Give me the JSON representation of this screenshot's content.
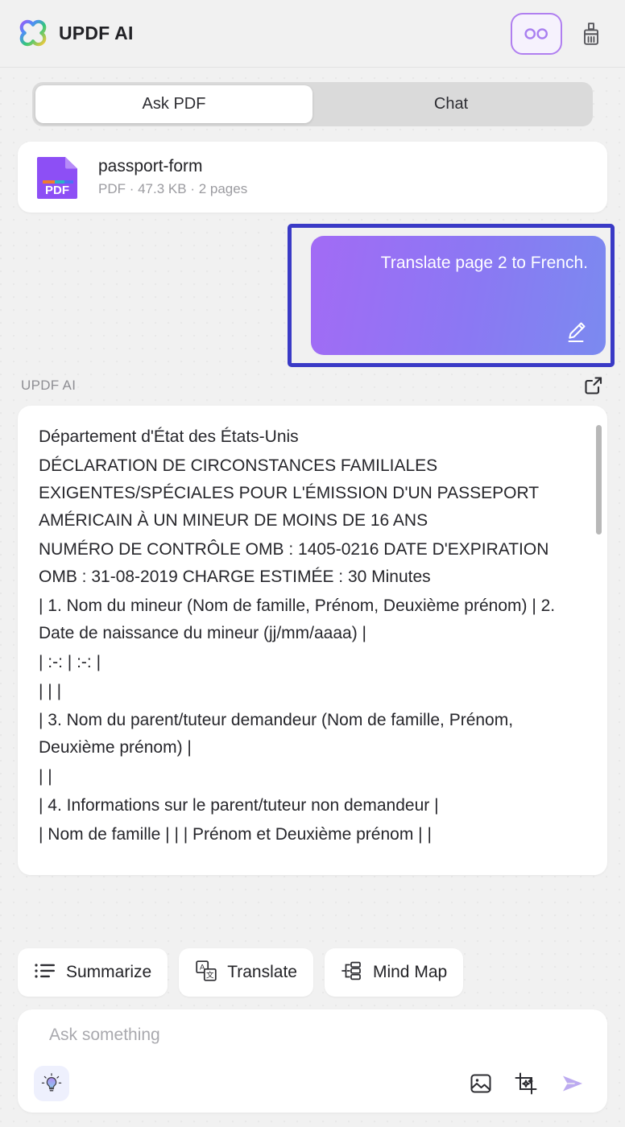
{
  "header": {
    "brand": "UPDF AI",
    "logo_icon": "clover-logo-icon",
    "credits_icon": "infinity-icon",
    "brush_icon": "brush-icon",
    "accent_purple": "#b07ff0"
  },
  "tabs": {
    "items": [
      {
        "label": "Ask PDF",
        "active": true
      },
      {
        "label": "Chat",
        "active": false
      }
    ]
  },
  "file": {
    "icon": "pdf-file-icon",
    "name": "passport-form",
    "meta": "PDF · 47.3 KB · 2 pages"
  },
  "conversation": {
    "user_message": {
      "text": "Translate page 2 to French.",
      "edit_icon": "pencil-edit-icon",
      "selected": true,
      "selection_color": "#3a3ac6",
      "gradient_from": "#a26bf5",
      "gradient_to": "#7b8af0"
    },
    "assistant": {
      "label": "UPDF AI",
      "expand_icon": "external-link-icon",
      "paragraphs": [
        "Département d'État des États-Unis",
        "DÉCLARATION DE CIRCONSTANCES FAMILIALES EXIGENTES/SPÉCIALES POUR L'ÉMISSION D'UN PASSEPORT AMÉRICAIN À UN MINEUR DE MOINS DE 16 ANS",
        "NUMÉRO DE CONTRÔLE OMB : 1405-0216 DATE D'EXPIRATION OMB : 31-08-2019 CHARGE ESTIMÉE : 30 Minutes",
        "| 1. Nom du mineur (Nom de famille, Prénom, Deuxième prénom) | 2. Date de naissance du mineur (jj/mm/aaaa) |",
        "| :-: | :-: |",
        "| | |",
        "| 3. Nom du parent/tuteur demandeur (Nom de famille, Prénom, Deuxième prénom) |",
        "| |",
        "| 4. Informations sur le parent/tuteur non demandeur |",
        "| Nom de famille | | | Prénom et Deuxième prénom | |"
      ]
    }
  },
  "quick_actions": [
    {
      "label": "Summarize",
      "icon": "list-summary-icon"
    },
    {
      "label": "Translate",
      "icon": "translate-icon"
    },
    {
      "label": "Mind Map",
      "icon": "mind-map-icon"
    }
  ],
  "composer": {
    "placeholder": "Ask something",
    "value": "",
    "bulb_icon": "lightbulb-idea-icon",
    "image_icon": "image-attach-icon",
    "snip_icon": "smart-snip-icon",
    "send_icon": "send-arrow-icon",
    "send_color": "#b9a9f0"
  }
}
